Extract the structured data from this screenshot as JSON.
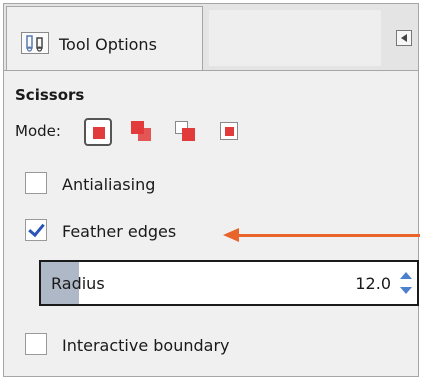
{
  "tab": {
    "icon": "tool-options-icon",
    "label": "Tool Options",
    "menu_icon": "tab-menu-left-arrow-icon"
  },
  "tool": {
    "title": "Scissors"
  },
  "mode": {
    "label": "Mode:",
    "options": [
      {
        "icon": "replace-selection-icon",
        "active": true
      },
      {
        "icon": "add-to-selection-icon",
        "active": false
      },
      {
        "icon": "subtract-from-selection-icon",
        "active": false
      },
      {
        "icon": "intersect-selection-icon",
        "active": false
      }
    ]
  },
  "antialiasing": {
    "label": "Antialiasing",
    "checked": false
  },
  "feather_edges": {
    "label": "Feather edges",
    "checked": true
  },
  "radius": {
    "label": "Radius",
    "value": "12.0",
    "fill_fraction": 0.1
  },
  "interactive_boundary": {
    "label": "Interactive boundary",
    "checked": false
  },
  "annotation": {
    "arrow_color": "#e8642a",
    "icon": "annotation-arrow-icon"
  },
  "colors": {
    "accent_red": "#e23b3b",
    "check_blue": "#2a55b8",
    "slider_fill": "#aeb8c6"
  }
}
